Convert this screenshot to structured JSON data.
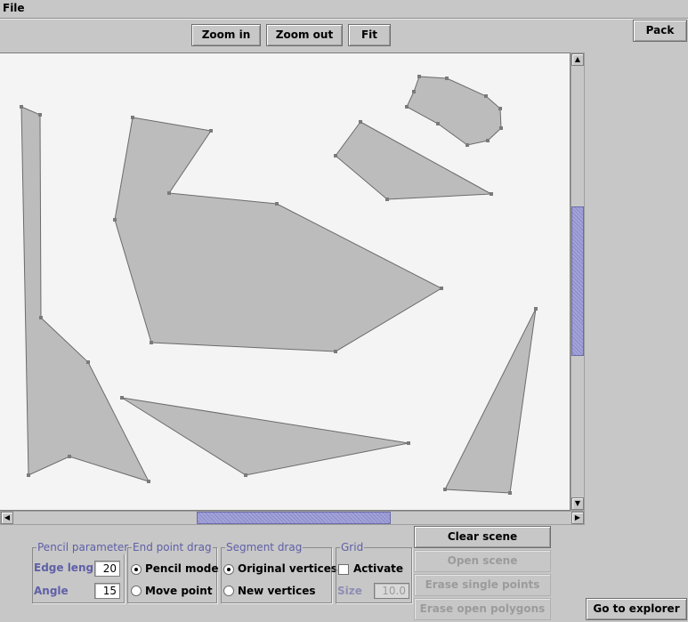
{
  "menu": {
    "file_label": "File"
  },
  "toolbar": {
    "zoom_in": "Zoom in",
    "zoom_out": "Zoom out",
    "fit": "Fit"
  },
  "side": {
    "pack": "Pack",
    "go_to_explorer": "Go to explorer"
  },
  "actions": {
    "clear_scene": "Clear scene",
    "open_scene": "Open scene",
    "erase_single_points": "Erase single points",
    "erase_open_polygons": "Erase open polygons"
  },
  "pencil": {
    "title": "Pencil parameter",
    "edge_label": "Edge lenght",
    "edge_value": "20",
    "angle_label": "Angle",
    "angle_value": "15"
  },
  "endpoint": {
    "title": "End point drag",
    "option1": "Pencil mode",
    "option2": "Move point",
    "selected": 1
  },
  "segment": {
    "title": "Segment drag",
    "option1": "Original vertices",
    "option2": "New vertices",
    "selected": 1
  },
  "grid": {
    "title": "Grid",
    "activate_label": "Activate",
    "activate_checked": false,
    "size_label": "Size",
    "size_value": "10.0"
  },
  "colors": {
    "canvas": "#f4f4f4",
    "polygon_fill": "#bcbcbc",
    "polygon_stroke": "#6b6b6b",
    "vertex": "#7a7a7a",
    "scroll_thumb": "#9a9ad4"
  },
  "scroll": {
    "horizontal_position": 0.5,
    "vertical_position": 0.42
  }
}
